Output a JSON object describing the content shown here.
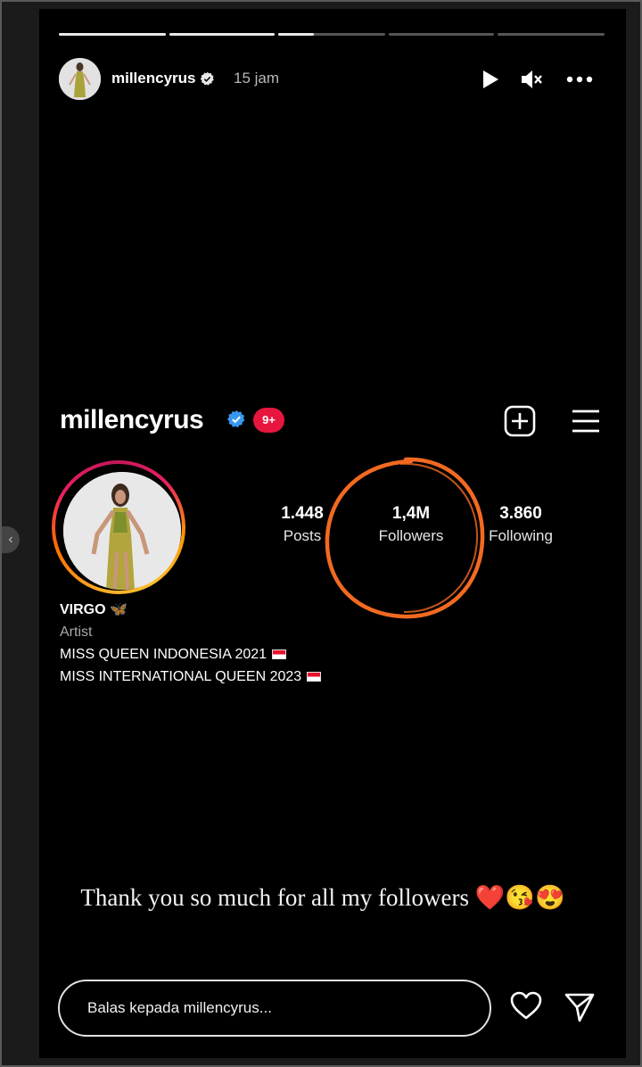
{
  "story": {
    "progress_segments": [
      1.0,
      1.0,
      0.33,
      0.0,
      0.0
    ],
    "username": "millencyrus",
    "time_ago": "15 jam"
  },
  "profile": {
    "username": "millencyrus",
    "notif_badge": "9+",
    "stats": [
      {
        "value": "1.448",
        "label": "Posts"
      },
      {
        "value": "1,4M",
        "label": "Followers"
      },
      {
        "value": "3.860",
        "label": "Following"
      }
    ],
    "bio": {
      "title": "VIRGO 🦋",
      "category": "Artist",
      "lines": [
        "MISS QUEEN INDONESIA 2021",
        "MISS INTERNATIONAL QUEEN 2023"
      ]
    }
  },
  "caption": "Thank you so much for all my followers ❤️😘😍",
  "reply": {
    "placeholder": "Balas kepada millencyrus..."
  },
  "colors": {
    "verified": "#3897f0",
    "badge": "#e6163f",
    "highlight": "#f26a21"
  },
  "icons": [
    "play-icon",
    "mute-icon",
    "more-icon",
    "add-post-icon",
    "menu-icon",
    "heart-icon",
    "send-icon",
    "verified-icon"
  ]
}
